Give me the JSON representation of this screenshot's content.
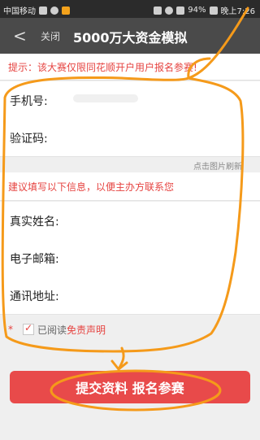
{
  "statusbar": {
    "carrier": "中国移动",
    "battery": "94%",
    "time": "晚上7:26",
    "icons": [
      "sim-icon",
      "notification-icon",
      "hd-icon",
      "wifi-icon",
      "signal-icon",
      "battery-icon"
    ]
  },
  "nav": {
    "back_icon": "chevron-left-icon",
    "close_label": "关闭",
    "title": "5000万大资金模拟"
  },
  "notice": {
    "text": "提示：该大赛仅限同花顺开户用户报名参赛!"
  },
  "form": {
    "phone_label": "手机号:",
    "captcha_label": "验证码:",
    "captcha_hint": "点击图片刷新",
    "section_title": "建议填写以下信息，以便主办方联系您",
    "realname_label": "真实姓名:",
    "email_label": "电子邮箱:",
    "address_label": "通讯地址:"
  },
  "agreement": {
    "required_mark": "*",
    "text": "已阅读",
    "link": "免责声明",
    "checked": true
  },
  "submit": {
    "label": "提交资料 报名参赛"
  },
  "colors": {
    "accent": "#e64340",
    "annotation": "#f59a1a",
    "navbar": "#4a4a4a"
  }
}
